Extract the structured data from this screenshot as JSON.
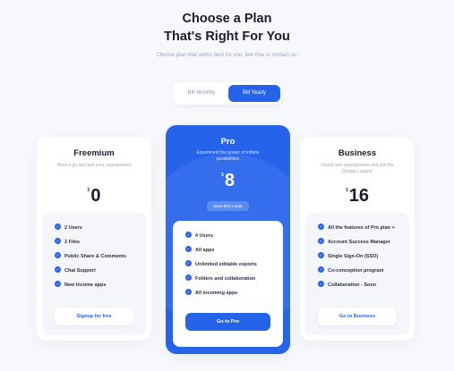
{
  "header": {
    "title_line1": "Choose a Plan",
    "title_line2": "That's Right For You",
    "subtitle": "Choose plan that works best for you, feel free to contact us."
  },
  "billing_toggle": {
    "monthly_label": "Bill Monthly",
    "yearly_label": "Bill Yearly",
    "selected": "Bill Yearly"
  },
  "plans": {
    "freemium": {
      "name": "Freemium",
      "description": "Have a go and test your superpowers",
      "currency": "$",
      "price": "0",
      "features": [
        "2 Users",
        "2 Files",
        "Public Share & Comments",
        "Chat Support",
        "New income apps"
      ],
      "cta": "Signup for free"
    },
    "pro": {
      "name": "Pro",
      "description": "Experiment the power of infinite possibilities",
      "currency": "$",
      "price": "8",
      "badge": "Save $50 a year",
      "features": [
        "4 Users",
        "All apps",
        "Unlimited editable exports",
        "Folders and collaboration",
        "All incoming apps"
      ],
      "cta": "Go to Pro"
    },
    "business": {
      "name": "Business",
      "description": "Unveil new superpowers and join the Design League",
      "currency": "$",
      "price": "16",
      "features": [
        "All the features of Pro plan +",
        "Account Success Manager",
        "Single Sign-On (SSO)",
        "Co-conception program",
        "Collaboration - Soon"
      ],
      "cta": "Go to Business"
    }
  },
  "colors": {
    "accent": "#2563eb",
    "background": "#f6f8fc",
    "card": "#ffffff",
    "feature_box": "#f4f6fa"
  }
}
